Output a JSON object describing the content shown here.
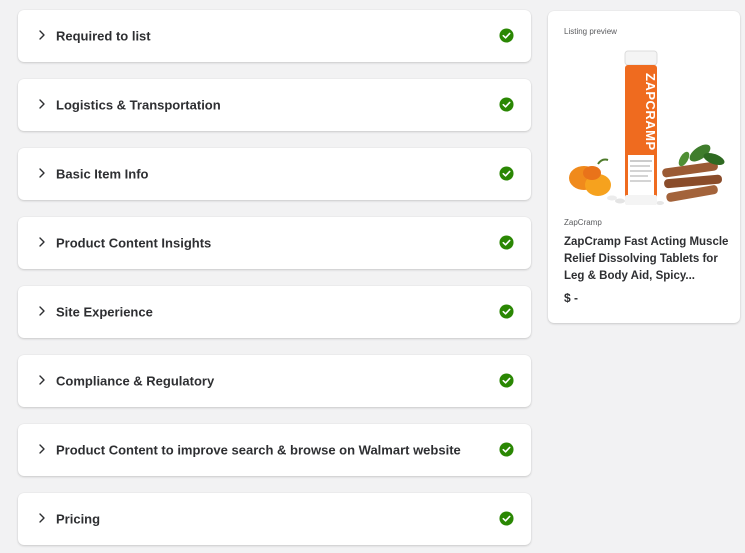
{
  "sections": [
    {
      "label": "Required to list",
      "status": "complete"
    },
    {
      "label": "Logistics & Transportation",
      "status": "complete"
    },
    {
      "label": "Basic Item Info",
      "status": "complete"
    },
    {
      "label": "Product Content Insights",
      "status": "complete"
    },
    {
      "label": "Site Experience",
      "status": "complete"
    },
    {
      "label": "Compliance & Regulatory",
      "status": "complete"
    },
    {
      "label": "Product Content to improve search & browse on Walmart website",
      "status": "complete"
    },
    {
      "label": "Pricing",
      "status": "complete"
    }
  ],
  "preview": {
    "heading": "Listing preview",
    "brand": "ZapCramp",
    "title": "ZapCramp Fast Acting Muscle Relief Dissolving Tablets for Leg & Body Aid, Spicy...",
    "price": "$ -",
    "product_image_text": "ZAPCRAMP"
  },
  "colors": {
    "check_green": "#2a8703",
    "tube_orange": "#ef6b1f",
    "background": "#f2f2f3"
  },
  "icons": {
    "expand": "chevron-right-icon",
    "status": "check-circle-icon"
  }
}
